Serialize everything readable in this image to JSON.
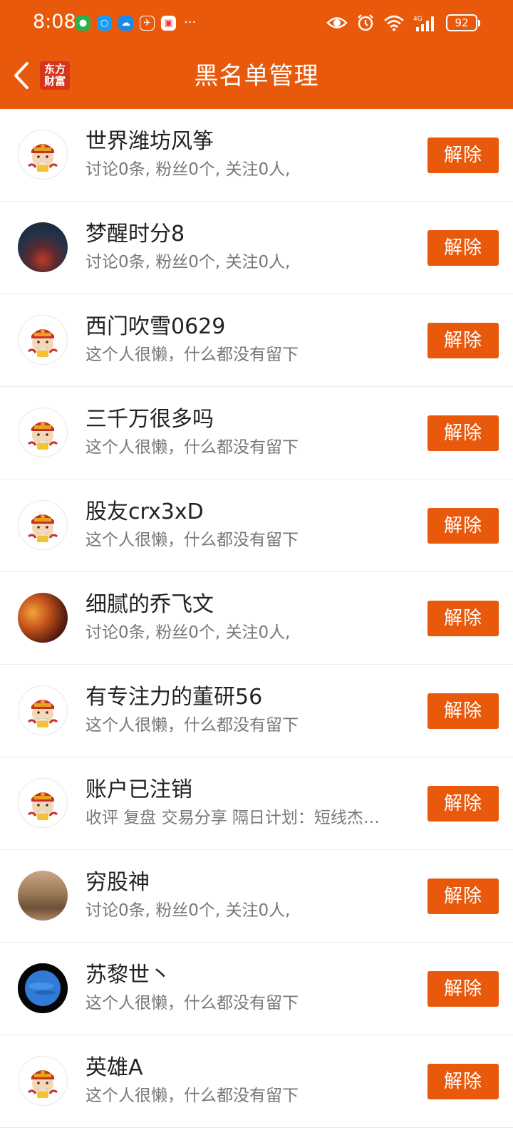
{
  "status_bar": {
    "time": "8:08",
    "battery": "92",
    "network": "4G"
  },
  "header": {
    "title": "黑名单管理",
    "logo_line1": "东方",
    "logo_line2": "财富"
  },
  "colors": {
    "brand": "#e8590c",
    "text_primary": "#222222",
    "text_secondary": "#777777"
  },
  "blocked_users": [
    {
      "name": "世界潍坊风筝",
      "desc": "讨论0条, 粉丝0个, 关注0人,",
      "avatar": "mascot",
      "action": "解除"
    },
    {
      "name": "梦醒时分8",
      "desc": "讨论0条, 粉丝0个, 关注0人,",
      "avatar": "night-street-photo",
      "action": "解除"
    },
    {
      "name": "西门吹雪0629",
      "desc": "这个人很懒，什么都没有留下",
      "avatar": "mascot",
      "action": "解除"
    },
    {
      "name": "三千万很多吗",
      "desc": "这个人很懒，什么都没有留下",
      "avatar": "mascot",
      "action": "解除"
    },
    {
      "name": "股友crx3xD",
      "desc": "这个人很懒，什么都没有留下",
      "avatar": "mascot",
      "action": "解除"
    },
    {
      "name": "细腻的乔飞文",
      "desc": "讨论0条, 粉丝0个, 关注0人,",
      "avatar": "warrior-photo",
      "action": "解除"
    },
    {
      "name": "有专注力的董研56",
      "desc": "这个人很懒，什么都没有留下",
      "avatar": "mascot",
      "action": "解除"
    },
    {
      "name": "账户已注销",
      "desc": "收评 复盘 交易分享 隔日计划：短线杰…",
      "avatar": "mascot",
      "action": "解除"
    },
    {
      "name": "穷股神",
      "desc": "讨论0条, 粉丝0个, 关注0人,",
      "avatar": "crowd-photo",
      "action": "解除"
    },
    {
      "name": "苏黎世丶",
      "desc": "这个人很懒，什么都没有留下",
      "avatar": "planet-photo",
      "action": "解除"
    },
    {
      "name": "英雄A",
      "desc": "这个人很懒，什么都没有留下",
      "avatar": "mascot",
      "action": "解除"
    }
  ]
}
